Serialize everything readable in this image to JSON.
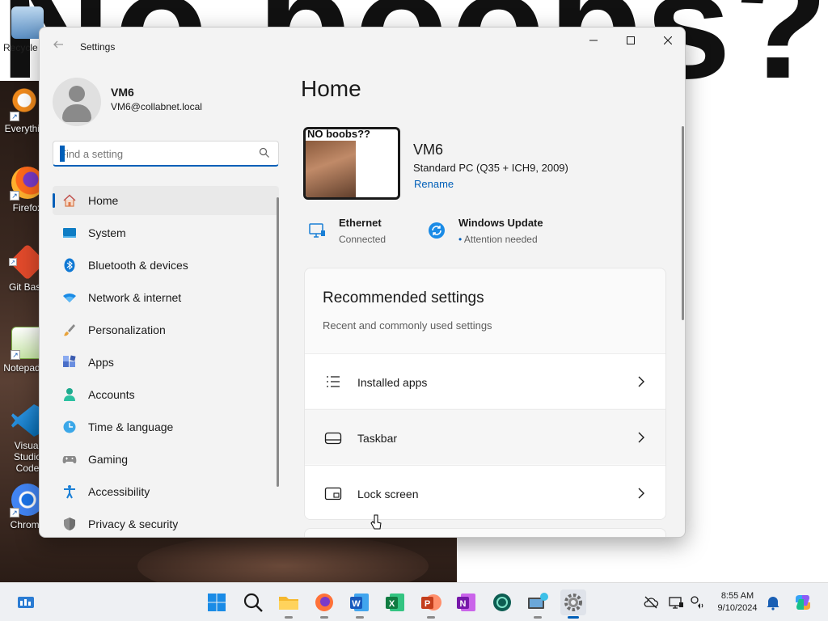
{
  "desktop": {
    "background_text": "No boobs??",
    "icons": [
      {
        "label": "Recycle Bin",
        "icon": "recycle-bin-icon"
      },
      {
        "label": "Everything",
        "icon": "search-magnifier-icon"
      },
      {
        "label": "Firefox",
        "icon": "firefox-icon"
      },
      {
        "label": "Git Bash",
        "icon": "git-icon"
      },
      {
        "label": "Notepad++",
        "icon": "notepad-plus-plus-icon"
      },
      {
        "label": "Visual Studio Code",
        "icon": "vscode-icon"
      },
      {
        "label": "Chrome",
        "icon": "chrome-icon"
      }
    ]
  },
  "window": {
    "title": "Settings",
    "controls": {
      "minimize": "—",
      "maximize": "☐",
      "close": "✕"
    }
  },
  "profile": {
    "name": "VM6",
    "email": "VM6@collabnet.local"
  },
  "search": {
    "placeholder": "Find a setting"
  },
  "nav": {
    "selected": "Home",
    "items": [
      {
        "label": "Home",
        "icon": "home-icon"
      },
      {
        "label": "System",
        "icon": "system-monitor-icon"
      },
      {
        "label": "Bluetooth & devices",
        "icon": "bluetooth-icon"
      },
      {
        "label": "Network & internet",
        "icon": "wifi-icon"
      },
      {
        "label": "Personalization",
        "icon": "brush-icon"
      },
      {
        "label": "Apps",
        "icon": "apps-icon"
      },
      {
        "label": "Accounts",
        "icon": "person-icon"
      },
      {
        "label": "Time & language",
        "icon": "globe-clock-icon"
      },
      {
        "label": "Gaming",
        "icon": "gamepad-icon"
      },
      {
        "label": "Accessibility",
        "icon": "accessibility-icon"
      },
      {
        "label": "Privacy & security",
        "icon": "shield-icon"
      }
    ]
  },
  "main": {
    "title": "Home",
    "device": {
      "thumb_text": "NO boobs??",
      "name": "VM6",
      "model": "Standard PC (Q35 + ICH9, 2009)",
      "rename": "Rename"
    },
    "status": [
      {
        "title": "Ethernet",
        "subtitle": "Connected",
        "icon": "ethernet-icon"
      },
      {
        "title": "Windows Update",
        "subtitle": "Attention needed",
        "icon": "windows-update-icon",
        "dot": "•"
      }
    ],
    "recommended": {
      "title": "Recommended settings",
      "subtitle": "Recent and commonly used settings",
      "rows": [
        {
          "label": "Installed apps",
          "icon": "list-icon"
        },
        {
          "label": "Taskbar",
          "icon": "taskbar-icon"
        },
        {
          "label": "Lock screen",
          "icon": "lock-screen-icon"
        }
      ]
    }
  },
  "taskbar": {
    "items": [
      {
        "name": "widgets",
        "icon": "widgets-icon"
      },
      {
        "name": "start",
        "icon": "windows-start-icon"
      },
      {
        "name": "search",
        "icon": "search-icon"
      },
      {
        "name": "file-explorer",
        "icon": "folder-icon"
      },
      {
        "name": "firefox",
        "icon": "firefox-icon"
      },
      {
        "name": "word",
        "icon": "word-icon"
      },
      {
        "name": "excel",
        "icon": "excel-icon"
      },
      {
        "name": "powerpoint",
        "icon": "powerpoint-icon"
      },
      {
        "name": "onenote",
        "icon": "onenote-icon"
      },
      {
        "name": "gitkraken",
        "icon": "gitkraken-icon"
      },
      {
        "name": "remote-desktop",
        "icon": "remote-desktop-icon"
      },
      {
        "name": "settings",
        "icon": "gear-icon"
      }
    ],
    "tray": [
      "cloud-offline-icon",
      "display-icon",
      "network-speaker-icon",
      "notification-bell-icon",
      "copilot-icon"
    ],
    "time": "8:55 AM",
    "date": "9/10/2024"
  },
  "colors": {
    "accent": "#005fb8",
    "window_bg": "#f3f3f3",
    "taskbar_bg": "#eef0f3"
  }
}
